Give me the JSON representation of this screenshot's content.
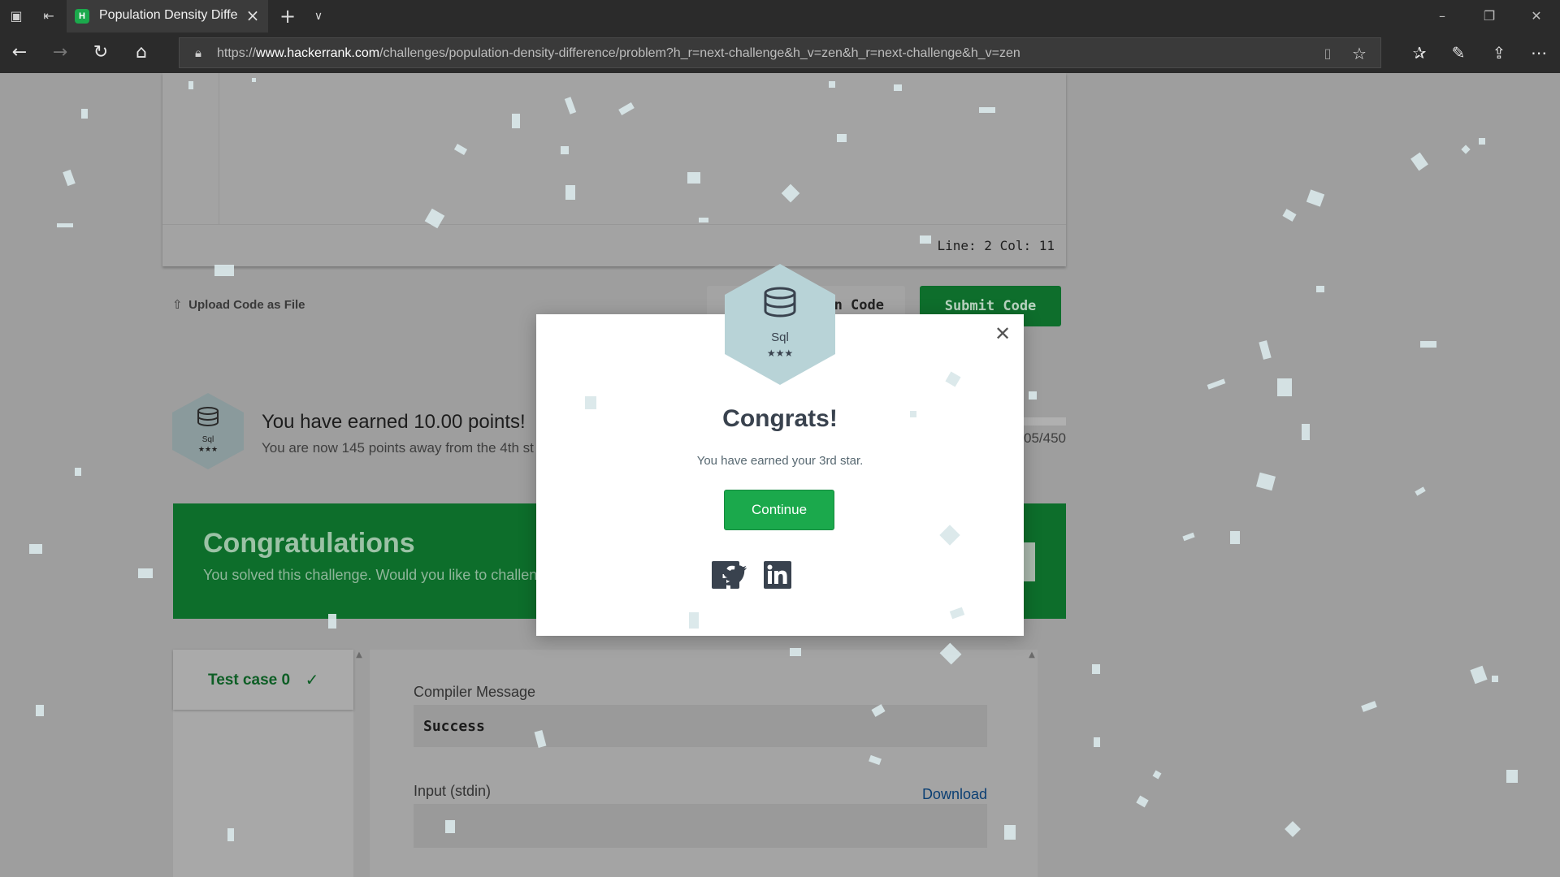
{
  "browser": {
    "tab_title": "Population Density Diffe",
    "tab_favicon_letter": "H",
    "url_prefix": "https://",
    "url_domain": "www.hackerrank.com",
    "url_path": "/challenges/population-density-difference/problem?h_r=next-challenge&h_v=zen&h_r=next-challenge&h_v=zen"
  },
  "editor": {
    "cursor_position": "Line: 2 Col: 11"
  },
  "actions": {
    "upload_label": "Upload Code as File",
    "run_label": "n Code",
    "submit_label": "Submit Code"
  },
  "points": {
    "badge_name": "Sql",
    "badge_stars": "★★★",
    "title": "You have earned 10.00 points!",
    "subtitle": "You are now 145 points away from the 4th st",
    "progress_text": "305/450"
  },
  "banner": {
    "title": "Congratulations",
    "subtitle": "You solved this challenge. Would you like to challen"
  },
  "tests": {
    "tab_label": "Test case 0",
    "compiler_label": "Compiler Message",
    "compiler_value": "Success",
    "input_label": "Input (stdin)",
    "download_label": "Download"
  },
  "modal": {
    "badge_name": "Sql",
    "badge_stars": "★★★",
    "title": "Congrats!",
    "subtitle": "You have earned your 3rd star.",
    "continue_label": "Continue",
    "close_symbol": "✕"
  },
  "colors": {
    "hackerrank_green": "#1ba94c",
    "banner_green": "#0d6e2b",
    "badge_fill": "#b8d3d7",
    "overlay_gray": "#9e9e9e",
    "confetti": "#d9e8ea"
  }
}
